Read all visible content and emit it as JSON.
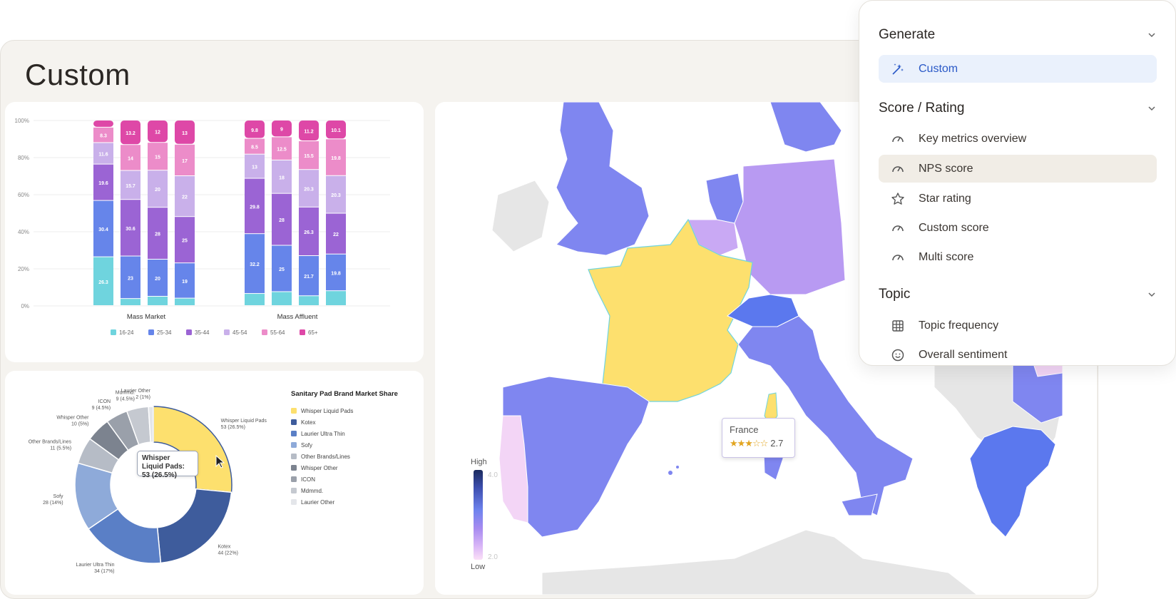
{
  "page": {
    "title": "Custom"
  },
  "bar_chart": {
    "chart_data": {
      "type": "bar",
      "stacked": true,
      "y_ticks": [
        "100%",
        "80%",
        "60%",
        "40%",
        "20%",
        "0%"
      ],
      "groups": [
        "Mass Market",
        "Mass Affluent"
      ],
      "legend": [
        "16-24",
        "25-34",
        "35-44",
        "45-54",
        "55-64",
        "65+"
      ],
      "colors": [
        "#6fd4de",
        "#6685ea",
        "#9b64d4",
        "#c9b0ea",
        "#ec8cc9",
        "#de48a7"
      ],
      "bars": [
        {
          "group": 0,
          "values": [
            26.3,
            30.4,
            19.6,
            11.6,
            8.3,
            3.8
          ],
          "labels": [
            "26.3",
            "30.4",
            "19.6",
            "11.6",
            "8.3",
            ""
          ]
        },
        {
          "group": 0,
          "values": [
            3.8,
            23,
            30.6,
            15.7,
            14,
            13.2
          ],
          "labels": [
            "",
            "23",
            "30.6",
            "15.7",
            "14",
            "13.2"
          ]
        },
        {
          "group": 0,
          "values": [
            5,
            20,
            28,
            20,
            15,
            12
          ],
          "labels": [
            "",
            "20",
            "28",
            "20",
            "15",
            "12"
          ]
        },
        {
          "group": 0,
          "values": [
            4,
            19,
            25,
            22,
            17,
            13
          ],
          "labels": [
            "",
            "19",
            "25",
            "22",
            "17",
            "13"
          ]
        },
        {
          "group": 1,
          "values": [
            6.5,
            32.2,
            29.8,
            13,
            8.5,
            9.8
          ],
          "labels": [
            "",
            "32.2",
            "29.8",
            "13",
            "8.5",
            "9.8"
          ]
        },
        {
          "group": 1,
          "values": [
            7.5,
            25,
            28,
            18,
            12.5,
            9
          ],
          "labels": [
            "",
            "25",
            "28",
            "18",
            "12.5",
            "9"
          ]
        },
        {
          "group": 1,
          "values": [
            5.3,
            21.7,
            26.3,
            20.3,
            15.5,
            11.2
          ],
          "labels": [
            "",
            "21.7",
            "26.3",
            "20.3",
            "15.5",
            "11.2"
          ]
        },
        {
          "group": 1,
          "values": [
            8,
            19.8,
            22,
            20.3,
            19.8,
            10.1
          ],
          "labels": [
            "",
            "19.8",
            "22",
            "20.3",
            "19.8",
            "10.1"
          ]
        }
      ]
    }
  },
  "donut_chart": {
    "chart_data": {
      "type": "pie",
      "title": "Sanitary Pad Brand Market Share",
      "slices": [
        {
          "name": "Whisper Liquid Pads",
          "value": 53,
          "label": "53 (26.5%)",
          "color": "#fde06e"
        },
        {
          "name": "Kotex",
          "value": 44,
          "label": "44 (22%)",
          "color": "#3e5c9c"
        },
        {
          "name": "Laurier Ultra Thin",
          "value": 34,
          "label": "34 (17%)",
          "color": "#5a7fc6"
        },
        {
          "name": "Sofy",
          "value": 28,
          "label": "28 (14%)",
          "color": "#8eaad9"
        },
        {
          "name": "Other Brands/Lines",
          "value": 11,
          "label": "11 (5.5%)",
          "color": "#b6bcc6"
        },
        {
          "name": "Whisper Other",
          "value": 10,
          "label": "10 (5%)",
          "color": "#7c838f"
        },
        {
          "name": "ICON",
          "value": 9,
          "label": "9 (4.5%)",
          "color": "#9aa0aa"
        },
        {
          "name": "Mdmmd.",
          "value": 9,
          "label": "9 (4.5%)",
          "color": "#c5c9d0"
        },
        {
          "name": "Laurier Other",
          "value": 2,
          "label": "2 (1%)",
          "color": "#e4e6ea"
        }
      ],
      "tooltip": "Whisper Liquid Pads: 53 (26.5%)"
    }
  },
  "map": {
    "legend_high": "High",
    "legend_low": "Low",
    "legend_max": "4.0",
    "legend_min": "2.0",
    "tooltip_country": "France",
    "tooltip_stars": "★★★☆☆",
    "tooltip_score": "2.7",
    "colors": {
      "france": "#fde06e",
      "blue": "#7f86f0",
      "purple": "#b89af2",
      "light": "#c9a9f4",
      "pink": "#f3d5f6",
      "deep": "#5b78ee",
      "gray": "#e6e6e6"
    }
  },
  "panel": {
    "sections": [
      {
        "title": "Generate",
        "items": [
          {
            "label": "Custom",
            "icon": "magic-wand-icon",
            "state": "active"
          }
        ]
      },
      {
        "title": "Score / Rating",
        "items": [
          {
            "label": "Key metrics overview",
            "icon": "gauge-icon"
          },
          {
            "label": "NPS score",
            "icon": "gauge-icon",
            "state": "hover"
          },
          {
            "label": "Star rating",
            "icon": "star-icon"
          },
          {
            "label": "Custom score",
            "icon": "gauge-icon"
          },
          {
            "label": "Multi score",
            "icon": "gauge-icon"
          }
        ]
      },
      {
        "title": "Topic",
        "items": [
          {
            "label": "Topic frequency",
            "icon": "grid-icon"
          },
          {
            "label": "Overall sentiment",
            "icon": "smile-icon"
          }
        ]
      }
    ]
  }
}
